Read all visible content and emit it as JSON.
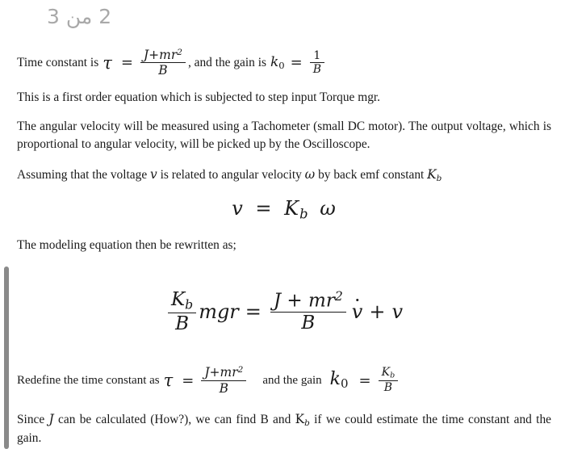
{
  "header": {
    "page_indicator": "2 من 3"
  },
  "document": {
    "line1": {
      "lead_text": "Time constant is",
      "tau_symbol": "τ",
      "equals": "=",
      "tau_numerator": "J+mr",
      "tau_num_exp": "2",
      "tau_denominator": "B",
      "mid_text": ", and the gain is",
      "gain_symbol": "k",
      "gain_sub": "0",
      "gain_equals": "=",
      "gain_numerator": "1",
      "gain_denominator": "B"
    },
    "para1": "This is a first order equation which is subjected to step input Torque mgr.",
    "para2": "The angular velocity will be measured using a Tachometer (small DC motor). The output voltage, which is proportional to angular velocity, will be picked up by the Oscilloscope.",
    "para3": {
      "part1": "Assuming that the voltage",
      "var_v": "v",
      "part2": "is related to angular velocity",
      "var_omega": "ω",
      "part3": "by back emf constant",
      "var_K": "K",
      "var_K_sub": "b"
    },
    "eq_backemf": {
      "lhs": "v",
      "equals": "=",
      "rhs_base": "K",
      "rhs_sub": "b",
      "rhs_omega": "ω"
    },
    "para4": "The modeling equation then be rewritten as;",
    "eq_main": {
      "lhs_frac_num_base": "K",
      "lhs_frac_num_sub": "b",
      "lhs_frac_den": "B",
      "lhs_term": "mgr",
      "equals": "=",
      "rhs_frac_num": "J + mr",
      "rhs_frac_num_exp": "2",
      "rhs_frac_den": "B",
      "rhs_vdot": "v",
      "plus": "+",
      "rhs_v": "v"
    },
    "line_redefine": {
      "lead_text": "Redefine the time constant as",
      "tau_symbol": "τ",
      "equals": "=",
      "tau_numerator": "J+mr",
      "tau_num_exp": "2",
      "tau_denominator": "B",
      "mid_text": "and the gain",
      "gain_symbol": "k",
      "gain_sub": "0",
      "gain_equals": "=",
      "gain_num_base": "K",
      "gain_num_sub": "b",
      "gain_denominator": "B"
    },
    "para5": {
      "part1": "Since",
      "var_J": "J",
      "part2": "can be calculated (How?), we can find B and",
      "var_K": "K",
      "var_K_sub": "b",
      "part3": "if we could estimate the time constant and the gain."
    }
  },
  "colors": {
    "background": "#ffffff",
    "text": "#1a1a1a",
    "header_gray": "#a9a9a9",
    "edge_bar": "#8a8a8a"
  }
}
